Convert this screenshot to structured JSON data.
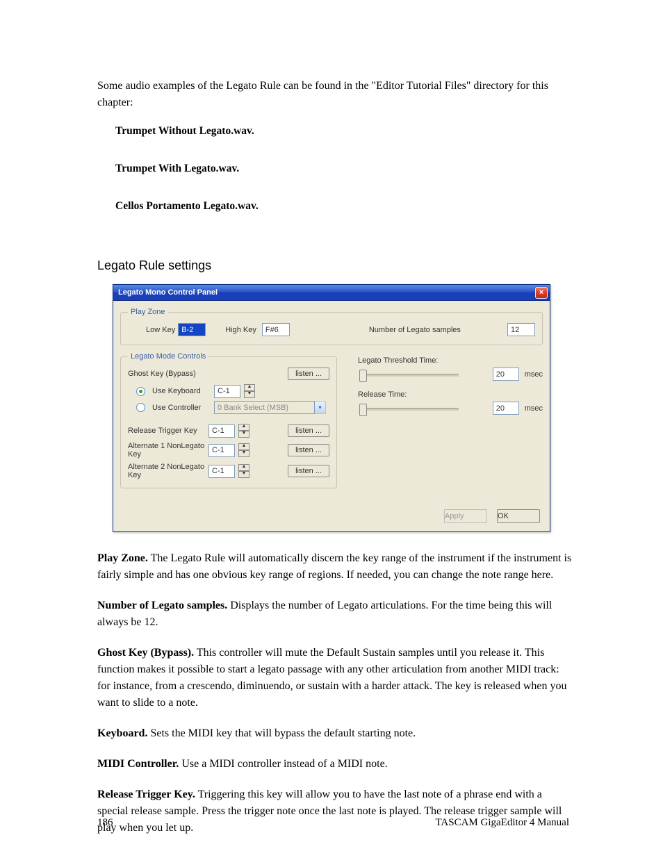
{
  "intro": "Some audio examples of the Legato Rule can be found in the \"Editor Tutorial Files\" directory for this chapter:",
  "files": [
    "Trumpet Without Legato.wav.",
    "Trumpet With Legato.wav.",
    "Cellos Portamento Legato.wav."
  ],
  "sectionTitle": "Legato Rule settings",
  "panel": {
    "title": "Legato Mono Control Panel",
    "playZone": {
      "legend": "Play Zone",
      "lowKeyLabel": "Low Key",
      "lowKeyValue": "B-2",
      "highKeyLabel": "High Key",
      "highKeyValue": "F#6",
      "numLegatoLabel": "Number of Legato samples",
      "numLegatoValue": "12"
    },
    "legatoMode": {
      "legend": "Legato Mode Controls",
      "ghostKey": "Ghost Key (Bypass)",
      "useKeyboard": "Use Keyboard",
      "useController": "Use Controller",
      "keyValue": "C-1",
      "controllerValue": "0 Bank Select (MSB)",
      "releaseTrigger": "Release Trigger Key",
      "alt1": "Alternate 1 NonLegato Key",
      "alt2": "Alternate 2 NonLegato Key",
      "listen": "listen ..."
    },
    "right": {
      "threshold": "Legato Threshold Time:",
      "release": "Release Time:",
      "value": "20",
      "unit": "msec"
    },
    "apply": "Apply",
    "ok": "OK"
  },
  "desc": [
    {
      "b": "Play Zone.",
      "t": "  The Legato Rule will automatically discern the key range of the instrument if the instrument is fairly simple and has one obvious key range of regions.  If needed, you can change the note range here."
    },
    {
      "b": "Number of Legato samples.",
      "t": "  Displays the number of Legato articulations.  For the time being this will always be 12."
    },
    {
      "b": "Ghost Key (Bypass).",
      "t": "  This controller will mute the Default Sustain samples until you release it. This function makes it possible to start a legato passage with any other articulation from another MIDI track: for instance, from a crescendo, diminuendo, or sustain with a harder attack.  The key is released when you want to slide to a note."
    },
    {
      "b": "Keyboard.",
      "t": "  Sets the MIDI key that will bypass the default starting note."
    },
    {
      "b": "MIDI Controller.",
      "t": "  Use a MIDI controller instead of a MIDI note."
    },
    {
      "b": "Release Trigger Key.",
      "t": "  Triggering this key will allow you to have the last note of a phrase end with a special release sample.  Press the trigger note once the last note is played.  The release trigger sample will play when you let up."
    }
  ],
  "footer": {
    "page": "186",
    "title": "TASCAM GigaEditor 4 Manual"
  }
}
